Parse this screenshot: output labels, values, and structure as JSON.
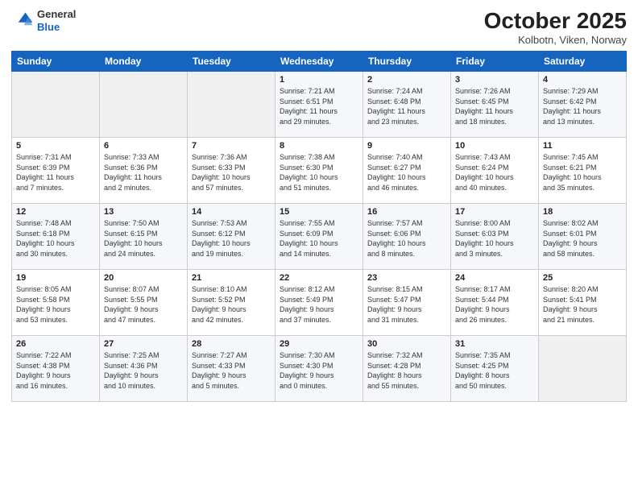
{
  "header": {
    "logo_general": "General",
    "logo_blue": "Blue",
    "title": "October 2025",
    "subtitle": "Kolbotn, Viken, Norway"
  },
  "weekdays": [
    "Sunday",
    "Monday",
    "Tuesday",
    "Wednesday",
    "Thursday",
    "Friday",
    "Saturday"
  ],
  "weeks": [
    [
      {
        "day": "",
        "info": ""
      },
      {
        "day": "",
        "info": ""
      },
      {
        "day": "",
        "info": ""
      },
      {
        "day": "1",
        "info": "Sunrise: 7:21 AM\nSunset: 6:51 PM\nDaylight: 11 hours\nand 29 minutes."
      },
      {
        "day": "2",
        "info": "Sunrise: 7:24 AM\nSunset: 6:48 PM\nDaylight: 11 hours\nand 23 minutes."
      },
      {
        "day": "3",
        "info": "Sunrise: 7:26 AM\nSunset: 6:45 PM\nDaylight: 11 hours\nand 18 minutes."
      },
      {
        "day": "4",
        "info": "Sunrise: 7:29 AM\nSunset: 6:42 PM\nDaylight: 11 hours\nand 13 minutes."
      }
    ],
    [
      {
        "day": "5",
        "info": "Sunrise: 7:31 AM\nSunset: 6:39 PM\nDaylight: 11 hours\nand 7 minutes."
      },
      {
        "day": "6",
        "info": "Sunrise: 7:33 AM\nSunset: 6:36 PM\nDaylight: 11 hours\nand 2 minutes."
      },
      {
        "day": "7",
        "info": "Sunrise: 7:36 AM\nSunset: 6:33 PM\nDaylight: 10 hours\nand 57 minutes."
      },
      {
        "day": "8",
        "info": "Sunrise: 7:38 AM\nSunset: 6:30 PM\nDaylight: 10 hours\nand 51 minutes."
      },
      {
        "day": "9",
        "info": "Sunrise: 7:40 AM\nSunset: 6:27 PM\nDaylight: 10 hours\nand 46 minutes."
      },
      {
        "day": "10",
        "info": "Sunrise: 7:43 AM\nSunset: 6:24 PM\nDaylight: 10 hours\nand 40 minutes."
      },
      {
        "day": "11",
        "info": "Sunrise: 7:45 AM\nSunset: 6:21 PM\nDaylight: 10 hours\nand 35 minutes."
      }
    ],
    [
      {
        "day": "12",
        "info": "Sunrise: 7:48 AM\nSunset: 6:18 PM\nDaylight: 10 hours\nand 30 minutes."
      },
      {
        "day": "13",
        "info": "Sunrise: 7:50 AM\nSunset: 6:15 PM\nDaylight: 10 hours\nand 24 minutes."
      },
      {
        "day": "14",
        "info": "Sunrise: 7:53 AM\nSunset: 6:12 PM\nDaylight: 10 hours\nand 19 minutes."
      },
      {
        "day": "15",
        "info": "Sunrise: 7:55 AM\nSunset: 6:09 PM\nDaylight: 10 hours\nand 14 minutes."
      },
      {
        "day": "16",
        "info": "Sunrise: 7:57 AM\nSunset: 6:06 PM\nDaylight: 10 hours\nand 8 minutes."
      },
      {
        "day": "17",
        "info": "Sunrise: 8:00 AM\nSunset: 6:03 PM\nDaylight: 10 hours\nand 3 minutes."
      },
      {
        "day": "18",
        "info": "Sunrise: 8:02 AM\nSunset: 6:01 PM\nDaylight: 9 hours\nand 58 minutes."
      }
    ],
    [
      {
        "day": "19",
        "info": "Sunrise: 8:05 AM\nSunset: 5:58 PM\nDaylight: 9 hours\nand 53 minutes."
      },
      {
        "day": "20",
        "info": "Sunrise: 8:07 AM\nSunset: 5:55 PM\nDaylight: 9 hours\nand 47 minutes."
      },
      {
        "day": "21",
        "info": "Sunrise: 8:10 AM\nSunset: 5:52 PM\nDaylight: 9 hours\nand 42 minutes."
      },
      {
        "day": "22",
        "info": "Sunrise: 8:12 AM\nSunset: 5:49 PM\nDaylight: 9 hours\nand 37 minutes."
      },
      {
        "day": "23",
        "info": "Sunrise: 8:15 AM\nSunset: 5:47 PM\nDaylight: 9 hours\nand 31 minutes."
      },
      {
        "day": "24",
        "info": "Sunrise: 8:17 AM\nSunset: 5:44 PM\nDaylight: 9 hours\nand 26 minutes."
      },
      {
        "day": "25",
        "info": "Sunrise: 8:20 AM\nSunset: 5:41 PM\nDaylight: 9 hours\nand 21 minutes."
      }
    ],
    [
      {
        "day": "26",
        "info": "Sunrise: 7:22 AM\nSunset: 4:38 PM\nDaylight: 9 hours\nand 16 minutes."
      },
      {
        "day": "27",
        "info": "Sunrise: 7:25 AM\nSunset: 4:36 PM\nDaylight: 9 hours\nand 10 minutes."
      },
      {
        "day": "28",
        "info": "Sunrise: 7:27 AM\nSunset: 4:33 PM\nDaylight: 9 hours\nand 5 minutes."
      },
      {
        "day": "29",
        "info": "Sunrise: 7:30 AM\nSunset: 4:30 PM\nDaylight: 9 hours\nand 0 minutes."
      },
      {
        "day": "30",
        "info": "Sunrise: 7:32 AM\nSunset: 4:28 PM\nDaylight: 8 hours\nand 55 minutes."
      },
      {
        "day": "31",
        "info": "Sunrise: 7:35 AM\nSunset: 4:25 PM\nDaylight: 8 hours\nand 50 minutes."
      },
      {
        "day": "",
        "info": ""
      }
    ]
  ]
}
